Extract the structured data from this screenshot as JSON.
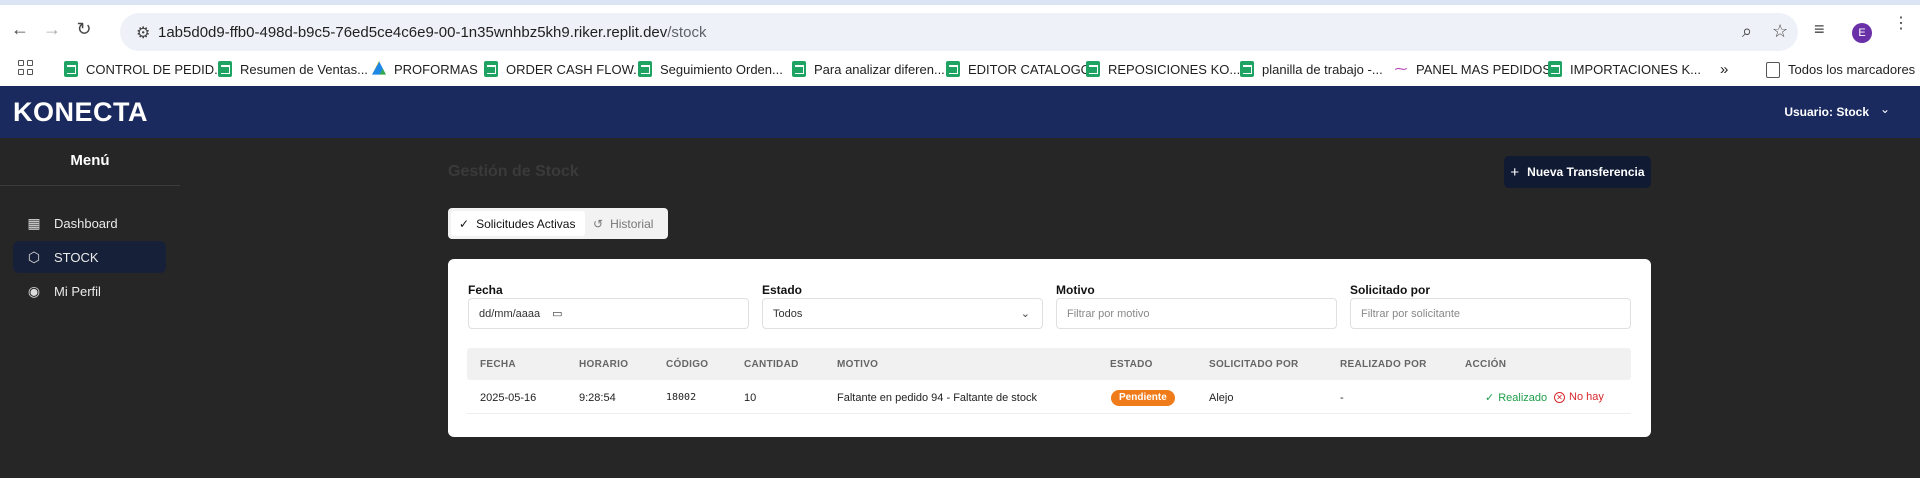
{
  "browser": {
    "url_host": "1ab5d0d9-ffb0-498d-b9c5-76ed5ce4c6e9-00-1n35wnhbz5kh9.riker.replit.dev",
    "url_path": "/stock",
    "profile_initial": "E",
    "bookmarks": [
      {
        "label": "CONTROL DE PEDID...",
        "icon": "sheets-icon"
      },
      {
        "label": "Resumen de Ventas...",
        "icon": "sheets-icon"
      },
      {
        "label": "PROFORMAS",
        "icon": "drive-icon"
      },
      {
        "label": "ORDER CASH FLOW...",
        "icon": "sheets-icon"
      },
      {
        "label": "Seguimiento Orden...",
        "icon": "sheets-icon"
      },
      {
        "label": "Para analizar diferen...",
        "icon": "sheets-icon"
      },
      {
        "label": "EDITOR CATALOGO",
        "icon": "sheets-icon"
      },
      {
        "label": "REPOSICIONES KO...",
        "icon": "sheets-icon"
      },
      {
        "label": "planilla de trabajo -...",
        "icon": "sheets-icon"
      },
      {
        "label": "PANEL MAS PEDIDOS",
        "icon": "panel-icon"
      },
      {
        "label": "IMPORTACIONES K...",
        "icon": "sheets-icon"
      }
    ],
    "all_bookmarks_label": "Todos los marcadores"
  },
  "app": {
    "brand": "KONECTA",
    "user_label": "Usuario: Stock"
  },
  "sidebar": {
    "title": "Menú",
    "items": [
      {
        "label": "Dashboard",
        "icon": "dashboard-icon"
      },
      {
        "label": "STOCK",
        "icon": "box-icon",
        "active": true
      },
      {
        "label": "Mi Perfil",
        "icon": "user-circle-icon"
      }
    ]
  },
  "main": {
    "title": "Gestión de Stock",
    "new_button": "Nueva Transferencia",
    "tabs": [
      {
        "label": "Solicitudes Activas",
        "active": true
      },
      {
        "label": "Historial",
        "active": false
      }
    ],
    "filters": {
      "fecha_label": "Fecha",
      "fecha_value": "dd/mm/aaaa",
      "estado_label": "Estado",
      "estado_value": "Todos",
      "motivo_label": "Motivo",
      "motivo_placeholder": "Filtrar por motivo",
      "solicitado_label": "Solicitado por",
      "solicitado_placeholder": "Filtrar por solicitante"
    },
    "table": {
      "columns": [
        "FECHA",
        "HORARIO",
        "CÓDIGO",
        "CANTIDAD",
        "MOTIVO",
        "ESTADO",
        "SOLICITADO POR",
        "REALIZADO POR",
        "ACCIÓN"
      ],
      "rows": [
        {
          "fecha": "2025-05-16",
          "horario": "9:28:54",
          "codigo": "18002",
          "cantidad": "10",
          "motivo": "Faltante en pedido 94 - Faltante de stock",
          "estado": "Pendiente",
          "solicitado_por": "Alejo",
          "realizado_por": "-",
          "accion_ok": "Realizado",
          "accion_no": "No hay"
        }
      ]
    }
  },
  "colors": {
    "appbar": "#1a2a5e",
    "badge_pending": "#f07b1a",
    "action_ok": "#1f9e4a",
    "action_no": "#d8272c"
  }
}
